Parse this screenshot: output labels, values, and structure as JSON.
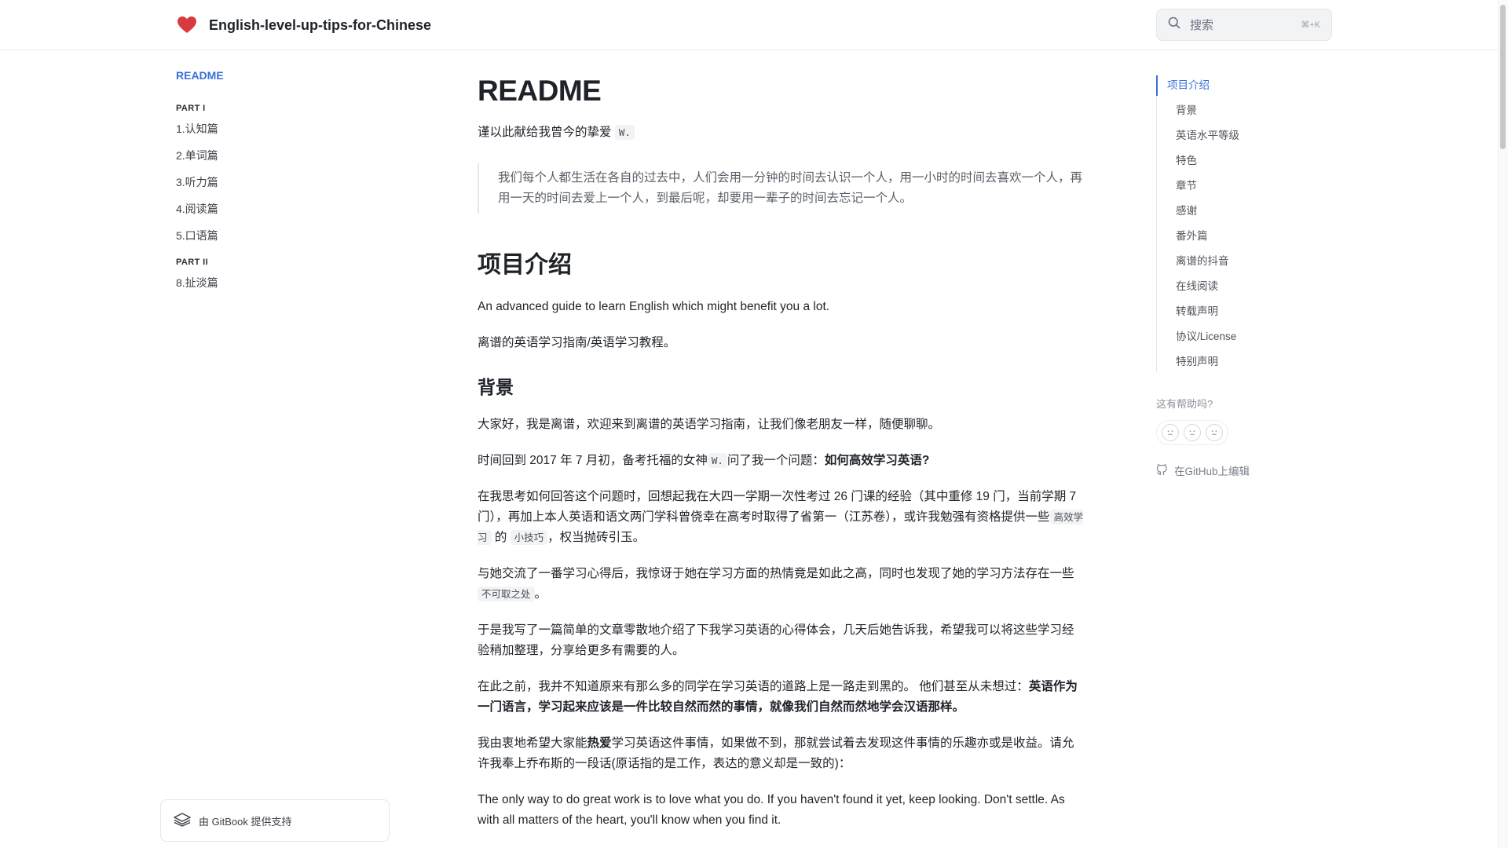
{
  "header": {
    "title": "English-level-up-tips-for-Chinese",
    "logo_icon": "heart-icon",
    "brand_color": "#d93a40",
    "search": {
      "placeholder": "搜索",
      "shortcut": "⌘+K"
    }
  },
  "sidebar": {
    "active": "README",
    "sections": [
      {
        "title": "PART I",
        "items": [
          "1.认知篇",
          "2.单词篇",
          "3.听力篇",
          "4.阅读篇",
          "5.口语篇"
        ]
      },
      {
        "title": "PART II",
        "items": [
          "8.扯淡篇"
        ]
      }
    ],
    "powered_by": "由 GitBook 提供支持"
  },
  "main": {
    "title": "README",
    "dedication": {
      "text": "谨以此献给我曾今的挚爱",
      "code": "W."
    },
    "quote": "我们每个人都生活在各自的过去中，人们会用一分钟的时间去认识一个人，用一小时的时间去喜欢一个人，再用一天的时间去爱上一个人，到最后呢，却要用一辈子的时间去忘记一个人。",
    "h2": "项目介绍",
    "intro_en": "An advanced guide to learn English which might benefit you a lot.",
    "intro_cn": "离谱的英语学习指南/英语学习教程。",
    "h3": "背景",
    "p1": "大家好，我是离谱，欢迎来到离谱的英语学习指南，让我们像老朋友一样，随便聊聊。",
    "p2": {
      "a": "时间回到 2017 年 7 月初，备考托福的女神",
      "code": "W.",
      "b": "问了我一个问题：",
      "bold": "如何高效学习英语?"
    },
    "p3": {
      "a": "在我思考如何回答这个问题时，回想起我在大四一学期一次性考过 26 门课的经验（其中重修 19 门，当前学期 7 门），再加上本人英语和语文两门学科曾侥幸在高考时取得了省第一（江苏卷），或许我勉强有资格提供一些",
      "code1": "高效学习",
      "b": "的",
      "code2": "小技巧",
      "c": "，权当抛砖引玉。"
    },
    "p4": {
      "a": "与她交流了一番学习心得后，我惊讶于她在学习方面的热情竟是如此之高，同时也发现了她的学习方法存在一些",
      "code": "不可取之处",
      "b": "。"
    },
    "p5": "于是我写了一篇简单的文章零散地介绍了下我学习英语的心得体会，几天后她告诉我，希望我可以将这些学习经验稍加整理，分享给更多有需要的人。",
    "p6": {
      "a": "在此之前，我并不知道原来有那么多的同学在学习英语的道路上是一路走到黑的。 他们甚至从未想过：",
      "bold": "英语作为一门语言，学习起来应该是一件比较自然而然的事情，就像我们自然而然地学会汉语那样。"
    },
    "p7": {
      "a": "我由衷地希望大家能",
      "bold": "热爱",
      "b": "学习英语这件事情，如果做不到，那就尝试着去发现这件事情的乐趣亦或是收益。请允许我奉上乔布斯的一段话(原话指的是工作，表达的意义却是一致的)："
    },
    "p8": "The only way to do great work is to love what you do. If you haven't found it yet, keep looking. Don't settle. As with all matters of the heart, you'll know when you find it."
  },
  "toc": {
    "items": [
      "项目介绍",
      "背景",
      "英语水平等级",
      "特色",
      "章节",
      "感谢",
      "番外篇",
      "离谱的抖音",
      "在线阅读",
      "转载声明",
      "协议/License",
      "特别声明"
    ],
    "helpful": "这有帮助吗?",
    "edit": "在GitHub上编辑"
  }
}
